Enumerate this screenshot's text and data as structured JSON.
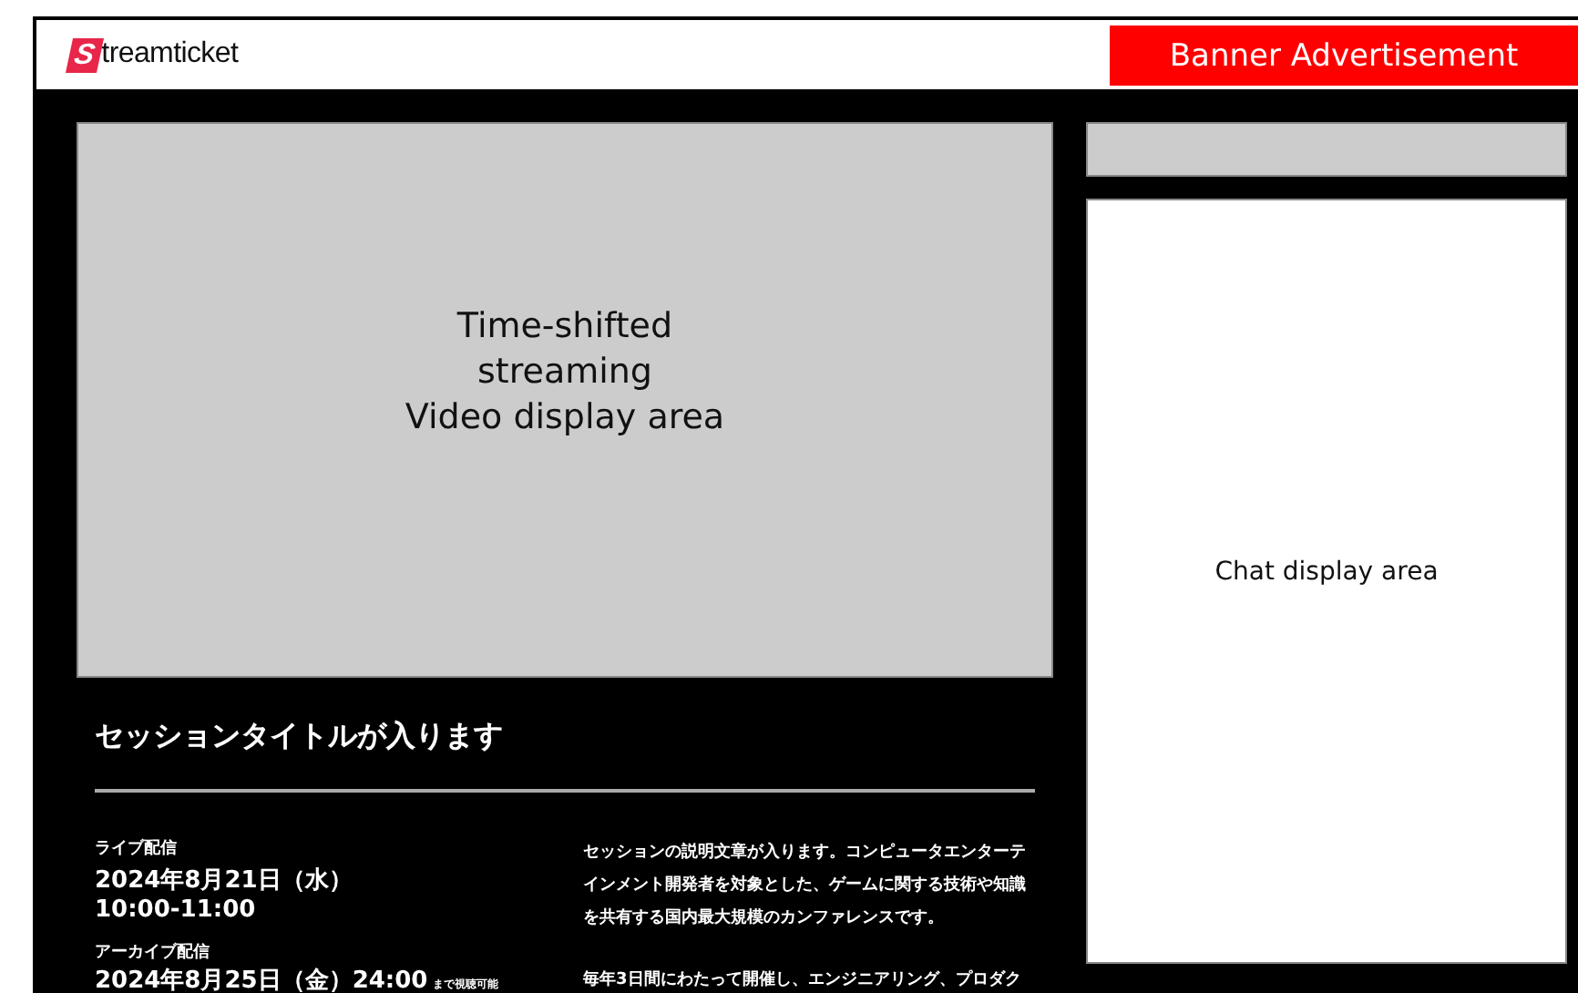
{
  "header": {
    "logo_letter": "S",
    "logo_text": "treamticket",
    "banner": "Banner Advertisement"
  },
  "video": {
    "text": "Time-shifted\nstreaming\nVideo display area"
  },
  "session": {
    "title": "セッションタイトルが入ります",
    "live_label": "ライブ配信",
    "live_date": "2024年8月21日（水）",
    "live_time": "10:00-11:00",
    "archive_label": "アーカイブ配信",
    "archive_date": "2024年8月25日（金）24:00",
    "archive_note": "まで視聴可能",
    "description": [
      "セッションの説明文章が入ります。コンピュータエンターテインメント開発者を対象とした、ゲームに関する技術や知識を共有する国内最大規模のカンファレンスです。",
      "毎年3日間にわたって開催し、エンジニアリング、プロダク"
    ]
  },
  "chat": {
    "text": "Chat display area"
  }
}
